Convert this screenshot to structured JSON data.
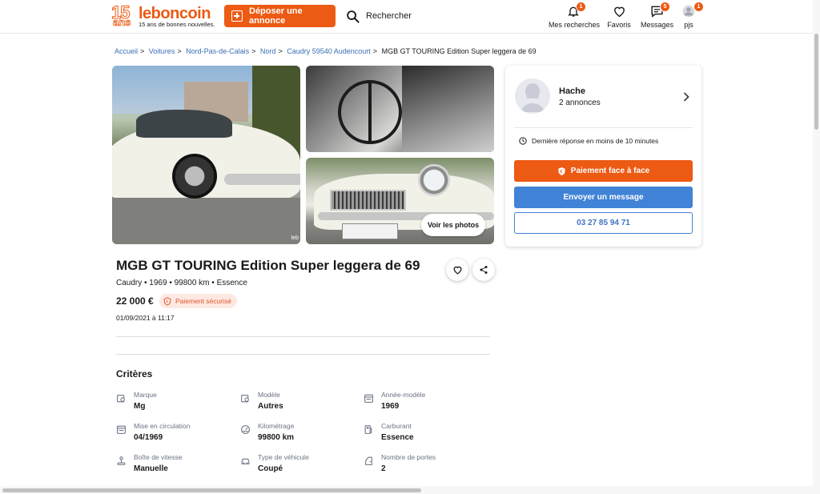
{
  "header": {
    "logo_number": "15",
    "logo_ans": "ans",
    "logo_word": "leboncoin",
    "logo_tagline": "15 ans de bonnes nouvelles.",
    "deposit_label": "Déposer une annonce",
    "search_label": "Rechercher",
    "nav": [
      {
        "label": "Mes recherches",
        "icon": "bell-icon",
        "badge": "1"
      },
      {
        "label": "Favoris",
        "icon": "heart-icon",
        "badge": ""
      },
      {
        "label": "Messages",
        "icon": "message-icon",
        "badge": "5"
      },
      {
        "label": "pjs",
        "icon": "user-icon",
        "badge": "1"
      }
    ],
    "accent": "#ec5a13"
  },
  "breadcrumb": [
    "Accueil",
    "Voitures",
    "Nord-Pas-de-Calais",
    "Nord",
    "Caudry 59540 Audencourt",
    "MGB GT TOURING Edition Super leggera de 69"
  ],
  "gallery": {
    "watermark": "leb",
    "see_photos": "Voir les photos"
  },
  "listing": {
    "title": "MGB GT TOURING Edition Super leggera de 69",
    "subtitle": "Caudry • 1969 • 99800 km • Essence",
    "price": "22 000 €",
    "secure_badge": "Paiement sécurisé",
    "date": "01/09/2021 à 11:17"
  },
  "criteria": {
    "title": "Critères",
    "items": [
      {
        "label": "Marque",
        "value": "Mg",
        "icon": "brand-icon"
      },
      {
        "label": "Modèle",
        "value": "Autres",
        "icon": "model-icon"
      },
      {
        "label": "Année-modèle",
        "value": "1969",
        "icon": "calendar-icon"
      },
      {
        "label": "Mise en circulation",
        "value": "04/1969",
        "icon": "calendar-icon"
      },
      {
        "label": "Kilométrage",
        "value": "99800 km",
        "icon": "gauge-icon"
      },
      {
        "label": "Carburant",
        "value": "Essence",
        "icon": "fuel-icon"
      },
      {
        "label": "Boîte de vitesse",
        "value": "Manuelle",
        "icon": "gearbox-icon"
      },
      {
        "label": "Type de véhicule",
        "value": "Coupé",
        "icon": "car-type-icon"
      },
      {
        "label": "Nombre de portes",
        "value": "2",
        "icon": "door-icon"
      }
    ]
  },
  "seller": {
    "name": "Hache",
    "ads_count": "2 annonces",
    "reply_time": "Dernière réponse en moins de 10 minutes",
    "pay_button": "Paiement face à face",
    "message_button": "Envoyer un message",
    "phone": "03 27 85 94 71"
  }
}
